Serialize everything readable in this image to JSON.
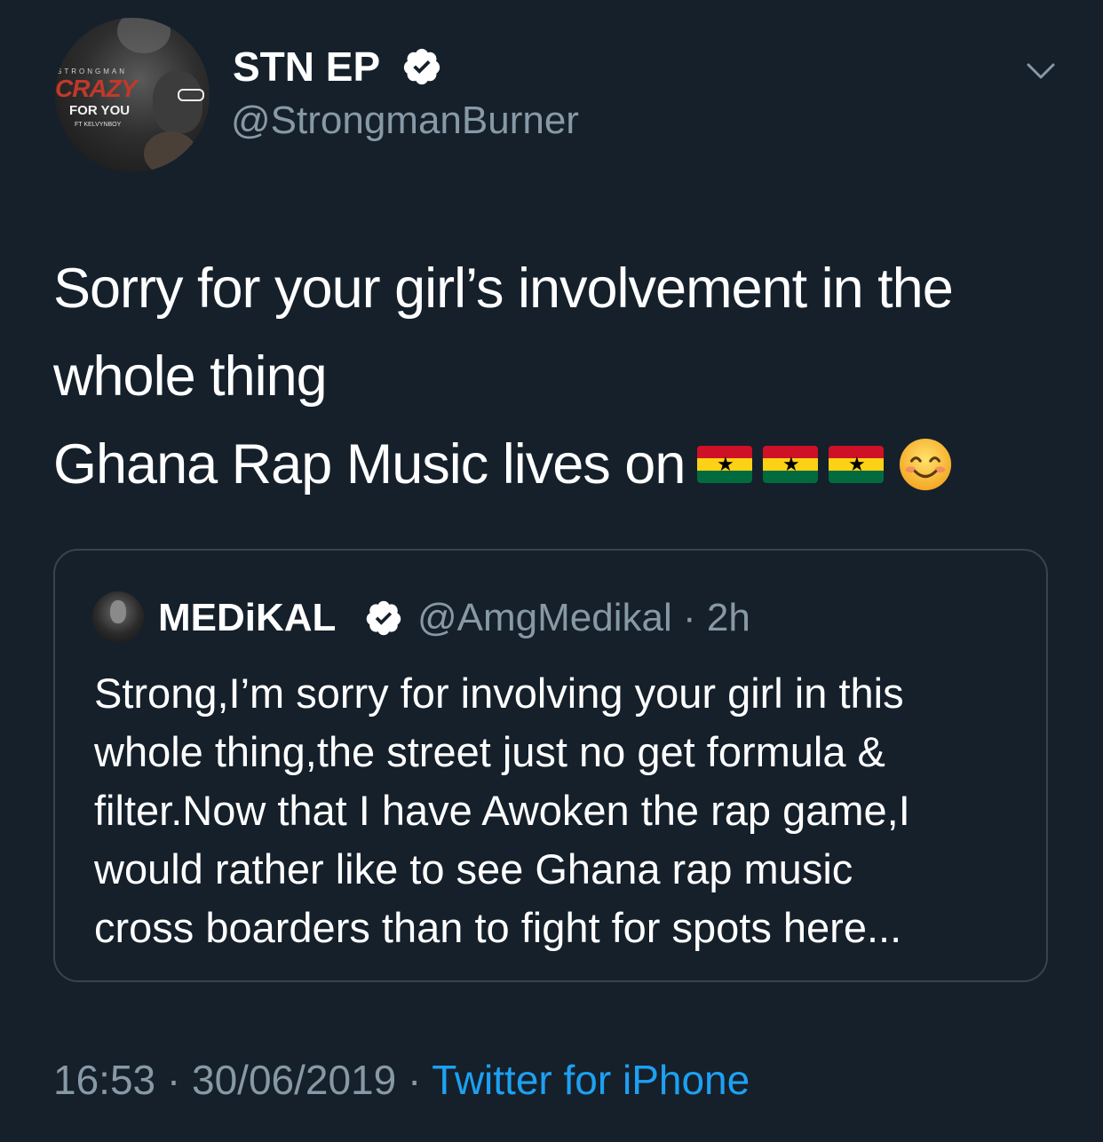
{
  "tweet": {
    "avatar": {
      "cover_top": "STRONGMAN",
      "cover_title": "CRAZY",
      "cover_subtitle": "FOR YOU",
      "cover_feat": "FT KELVYNBOY"
    },
    "display_name": "STN EP",
    "handle": "@StrongmanBurner",
    "text_lines": [
      "Sorry for your girl’s involvement in the",
      "whole thing",
      "Ghana Rap Music lives on"
    ],
    "emoji": [
      "ghana-flag-icon",
      "ghana-flag-icon",
      "ghana-flag-icon",
      "smiling-face-icon"
    ],
    "timestamp": "16:53 · 30/06/2019 · ",
    "source": "Twitter for iPhone"
  },
  "quoted_tweet": {
    "display_name": "MEDiKAL",
    "meta": "@AmgMedikal · 2h",
    "text_lines": [
      "Strong,I’m sorry for involving your girl in this",
      "whole thing,the street just no get formula &",
      "filter.Now that I have Awoken the rap game,I",
      "would rather like to see Ghana rap music",
      "cross boarders than to fight for spots here..."
    ]
  },
  "colors": {
    "background": "#15202b",
    "secondary_text": "#8899a6",
    "link": "#1da1f2",
    "border": "#38444d"
  }
}
